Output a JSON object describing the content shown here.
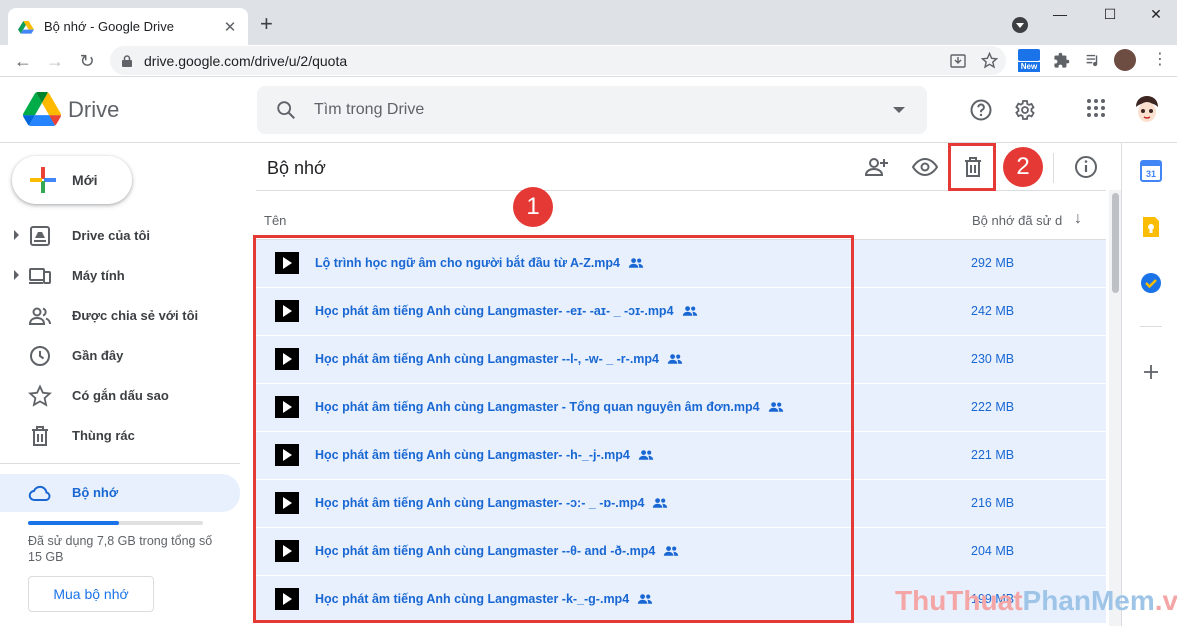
{
  "browser": {
    "tab_title": "Bộ nhớ - Google Drive",
    "tab_close": "✕",
    "new_tab": "+",
    "url": "drive.google.com/drive/u/2/quota",
    "window_controls": [
      "—",
      "☐",
      "✕"
    ],
    "nav": {
      "back": "←",
      "forward": "→",
      "reload": "↻"
    },
    "ext_new_badge": "New"
  },
  "header": {
    "app_name": "Drive",
    "search_placeholder": "Tìm trong Drive"
  },
  "sidebar": {
    "new_label": "Mới",
    "items": [
      {
        "label": "Drive của tôi",
        "icon": "my-drive-icon",
        "expandable": true
      },
      {
        "label": "Máy tính",
        "icon": "computer-icon",
        "expandable": true
      },
      {
        "label": "Được chia sẻ với tôi",
        "icon": "shared-icon",
        "expandable": false
      },
      {
        "label": "Gần đây",
        "icon": "clock-icon",
        "expandable": false
      },
      {
        "label": "Có gắn dấu sao",
        "icon": "star-icon",
        "expandable": false
      },
      {
        "label": "Thùng rác",
        "icon": "trash-icon",
        "expandable": false
      }
    ],
    "storage_label": "Bộ nhớ",
    "quota_fraction": 0.52,
    "quota_text": "Đã sử dụng 7,8 GB trong tổng số 15 GB",
    "buy_label": "Mua bộ nhớ"
  },
  "main": {
    "title": "Bộ nhớ",
    "col_name": "Tên",
    "col_size": "Bộ nhớ đã sử dụng",
    "sort_arrow": "↓",
    "files": [
      {
        "name": "Lộ trình học ngữ âm cho người bắt đầu từ A-Z.mp4",
        "size": "292 MB"
      },
      {
        "name": "Học phát âm tiếng Anh cùng Langmaster- -eɪ- -aɪ- _ -ɔɪ-.mp4",
        "size": "242 MB"
      },
      {
        "name": "Học phát âm tiếng Anh cùng Langmaster --l-, -w- _ -r-.mp4",
        "size": "230 MB"
      },
      {
        "name": "Học phát âm tiếng Anh cùng Langmaster - Tổng quan nguyên âm đơn.mp4",
        "size": "222 MB"
      },
      {
        "name": "Học phát âm tiếng Anh cùng Langmaster- -h-_-j-.mp4",
        "size": "221 MB"
      },
      {
        "name": "Học phát âm tiếng Anh cùng Langmaster- -ɔ:- _ -ɒ-.mp4",
        "size": "216 MB"
      },
      {
        "name": "Học phát âm tiếng Anh cùng Langmaster --θ- and -ð-.mp4",
        "size": "204 MB"
      },
      {
        "name": "Học phát âm tiếng Anh cùng Langmaster -k-_-g-.mp4",
        "size": "199 MB"
      }
    ]
  },
  "annotations": {
    "badge1": "1",
    "badge2": "2"
  },
  "watermark": {
    "part1": "ThuThuat",
    "part2": "PhanMem",
    "part3": ".vn"
  },
  "colors": {
    "accent": "#1a73e8",
    "selected_row": "#e8f0fe",
    "annotation_red": "#e53935"
  }
}
